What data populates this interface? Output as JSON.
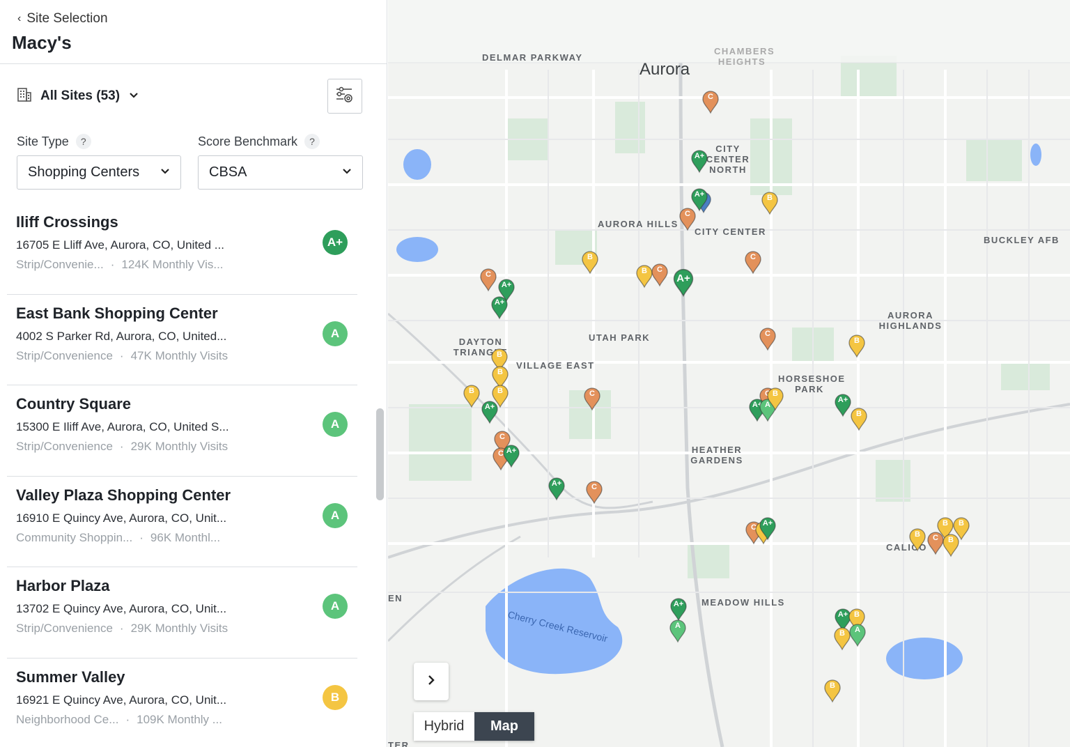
{
  "header": {
    "back_label": "Site Selection",
    "title": "Macy's"
  },
  "sites_selector": {
    "label": "All Sites (53)"
  },
  "filters": {
    "site_type": {
      "label": "Site Type",
      "help": "?",
      "value": "Shopping Centers"
    },
    "score_benchmark": {
      "label": "Score Benchmark",
      "help": "?",
      "value": "CBSA"
    }
  },
  "sites": [
    {
      "name": "Iliff Crossings",
      "address": "16705 E Lliff Ave, Aurora, CO, United ...",
      "type": "Strip/Convenie...",
      "visits": "124K Monthly Vis...",
      "grade": "A+",
      "grade_color": "#2e9e5b"
    },
    {
      "name": "East Bank Shopping Center",
      "address": "4002 S Parker Rd, Aurora, CO, United...",
      "type": "Strip/Convenience",
      "visits": "47K Monthly Visits",
      "grade": "A",
      "grade_color": "#5cc47b"
    },
    {
      "name": "Country Square",
      "address": "15300 E Iliff Ave, Aurora, CO, United S...",
      "type": "Strip/Convenience",
      "visits": "29K Monthly Visits",
      "grade": "A",
      "grade_color": "#5cc47b"
    },
    {
      "name": "Valley Plaza Shopping Center",
      "address": "16910 E Quincy Ave, Aurora, CO, Unit...",
      "type": "Community Shoppin...",
      "visits": "96K Monthl...",
      "grade": "A",
      "grade_color": "#5cc47b"
    },
    {
      "name": "Harbor Plaza",
      "address": "13702 E Quincy Ave, Aurora, CO, Unit...",
      "type": "Strip/Convenience",
      "visits": "29K Monthly Visits",
      "grade": "A",
      "grade_color": "#5cc47b"
    },
    {
      "name": "Summer Valley",
      "address": "16921 E Quincy Ave, Aurora, CO, Unit...",
      "type": "Neighborhood Ce...",
      "visits": "109K Monthly ...",
      "grade": "B",
      "grade_color": "#f4c542"
    }
  ],
  "map": {
    "labels": {
      "delmar": "DELMAR PARKWAY",
      "chambers": "CHAMBERS HEIGHTS",
      "aurora": "Aurora",
      "ccnorth": "CITY CENTER NORTH",
      "aurorahills": "AURORA HILLS",
      "citycenter": "CITY CENTER",
      "buckley": "BUCKLEY AFB",
      "aurorahighlands": "AURORA HIGHLANDS",
      "dayton": "DAYTON TRIANGLE",
      "utahpark": "UTAH PARK",
      "villageeast": "VILLAGE EAST",
      "horseshoe": "HORSESHOE PARK",
      "heather": "HEATHER GARDENS",
      "calico": "CALICO",
      "meadow": "MEADOW HILLS",
      "lake": "Cherry Creek Reservoir",
      "en": "EN",
      "ter": "TER"
    },
    "grade_colors": {
      "A+": "#2e9e5b",
      "A": "#5cc47b",
      "B": "#f4c542",
      "C": "#e3915b",
      "blue": "#4a7fc1"
    },
    "pins": [
      "C",
      "A+",
      "A+",
      "B",
      "C",
      "B",
      "B",
      "C",
      "A+",
      "C",
      "A+",
      "A+",
      "C",
      "B",
      "B",
      "B",
      "B",
      "C",
      "A+",
      "C",
      "B",
      "C",
      "A+",
      "A",
      "B",
      "A+",
      "B",
      "C",
      "C",
      "A+",
      "C",
      "A+",
      "C",
      "B",
      "B",
      "C",
      "B",
      "B",
      "A+",
      "A+",
      "A",
      "A+",
      "B",
      "B",
      "A",
      "B",
      "B"
    ],
    "map_type": {
      "hybrid": "Hybrid",
      "map": "Map"
    }
  }
}
